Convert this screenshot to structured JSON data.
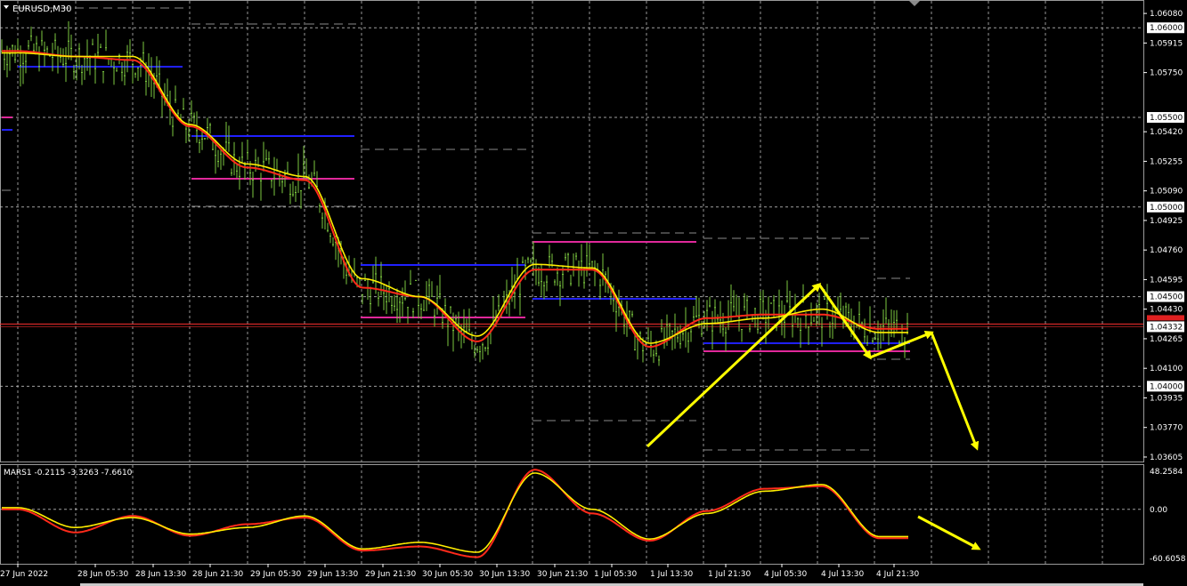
{
  "header": {
    "symbol_label": "EURUSD,M30"
  },
  "indicator": {
    "label": "MARS1 -0.2115 -3.3263 -7.6610"
  },
  "price_axis": {
    "ticks": [
      "1.06080",
      "1.05915",
      "1.05750",
      "1.05420",
      "1.05255",
      "1.05090",
      "1.04925",
      "1.04760",
      "1.04595",
      "1.04430",
      "1.04265",
      "1.04100",
      "1.03935",
      "1.03770",
      "1.03605"
    ],
    "boxed_levels": [
      "1.06000",
      "1.05500",
      "1.05000",
      "1.04500",
      "1.04000"
    ],
    "current_price": "1.04332"
  },
  "indicator_axis": {
    "ticks": [
      "48.2584",
      "0.00",
      "-60.6058"
    ]
  },
  "time_axis": {
    "labels": [
      "27 Jun 2022",
      "28 Jun 05:30",
      "28 Jun 13:30",
      "28 Jun 21:30",
      "29 Jun 05:30",
      "29 Jun 13:30",
      "29 Jun 21:30",
      "30 Jun 05:30",
      "30 Jun 13:30",
      "30 Jun 21:30",
      "1 Jul 05:30",
      "1 Jul 13:30",
      "1 Jul 21:30",
      "4 Jul 05:30",
      "4 Jul 13:30",
      "4 Jul 21:30"
    ]
  },
  "colors": {
    "background": "#000000",
    "grid": "#c8c8c8",
    "price_bars": "#7bc73f",
    "ma_fast": "#ff2a1a",
    "ma_slow": "#ffee00",
    "arrows": "#ffff00",
    "pivot_blue": "#2020ff",
    "pivot_magenta": "#e0289a",
    "current_line": "#ff3030"
  },
  "chart_data": [
    {
      "type": "line",
      "title": "EURUSD,M30",
      "x": [
        "27 Jun 2022",
        "28 Jun 05:30",
        "28 Jun 13:30",
        "28 Jun 21:30",
        "29 Jun 05:30",
        "29 Jun 13:30",
        "29 Jun 21:30",
        "30 Jun 05:30",
        "30 Jun 13:30",
        "30 Jun 21:30",
        "1 Jul 05:30",
        "1 Jul 13:30",
        "1 Jul 21:30",
        "4 Jul 05:30",
        "4 Jul 13:30",
        "4 Jul 21:30"
      ],
      "ylim": [
        1.0358,
        1.0615
      ],
      "series": [
        {
          "values": [
            1.0587,
            1.0584,
            1.0582,
            1.0545,
            1.0522,
            1.0515,
            1.0455,
            1.045,
            1.0425,
            1.0465,
            1.0465,
            1.0422,
            1.0438,
            1.044,
            1.044,
            1.0432
          ]
        },
        {
          "values": [
            1.0586,
            1.0584,
            1.0584,
            1.0546,
            1.0524,
            1.0517,
            1.046,
            1.045,
            1.0428,
            1.0468,
            1.0466,
            1.0424,
            1.0435,
            1.0438,
            1.0443,
            1.043
          ]
        }
      ],
      "reference_lines": [
        1.06,
        1.055,
        1.05,
        1.045,
        1.04
      ],
      "current_price": 1.04332
    },
    {
      "type": "line",
      "title": "MARS1 -0.2115 -3.3263 -7.6610",
      "x": [
        "27 Jun 2022",
        "28 Jun 05:30",
        "28 Jun 13:30",
        "28 Jun 21:30",
        "29 Jun 05:30",
        "29 Jun 13:30",
        "29 Jun 21:30",
        "30 Jun 05:30",
        "30 Jun 13:30",
        "30 Jun 21:30",
        "1 Jul 05:30",
        "1 Jul 13:30",
        "1 Jul 21:30",
        "4 Jul 05:30",
        "4 Jul 13:30",
        "4 Jul 21:30"
      ],
      "ylim": [
        -60.6058,
        48.2584
      ],
      "series": [
        {
          "values": [
            0,
            -28,
            -8,
            -32,
            -18,
            -10,
            -50,
            -45,
            -58,
            48,
            -5,
            -38,
            -2,
            25,
            28,
            -35
          ]
        },
        {
          "values": [
            2,
            -22,
            -10,
            -30,
            -22,
            -8,
            -48,
            -40,
            -52,
            44,
            0,
            -36,
            -5,
            22,
            30,
            -33
          ]
        }
      ]
    }
  ]
}
